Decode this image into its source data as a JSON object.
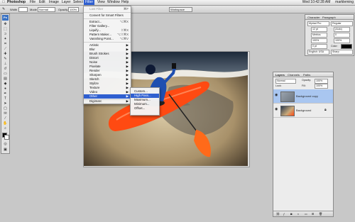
{
  "menubar": {
    "app": "Photoshop",
    "items": [
      "File",
      "Edit",
      "Image",
      "Layer",
      "Select",
      "Filter",
      "View",
      "Window",
      "Help"
    ],
    "clock": "Wed 10:42:28 AM",
    "user": "markleming"
  },
  "options": {
    "width_label": "Width",
    "mode_label": "Mode",
    "mode_value": "Normal",
    "opacity_label": "Opacity",
    "opacity_value": "100%",
    "workspace_label": "Workspace"
  },
  "toolbox": {
    "logo": "Ps"
  },
  "filter_menu": {
    "last_filter": "Last Filter",
    "last_filter_key": "⌘F",
    "convert": "Convert for Smart Filters",
    "group1": [
      {
        "label": "Extract...",
        "key": "⌥⌘X"
      },
      {
        "label": "Filter Gallery...",
        "key": ""
      },
      {
        "label": "Liquify...",
        "key": "⇧⌘X"
      },
      {
        "label": "Pattern Maker...",
        "key": "⌥⇧⌘X"
      },
      {
        "label": "Vanishing Point...",
        "key": "⌥⌘V"
      }
    ],
    "group2": [
      "Artistic",
      "Blur",
      "Brush Strokes",
      "Distort",
      "Noise",
      "Pixelate",
      "Render",
      "Sharpen",
      "Sketch",
      "Stylize",
      "Texture",
      "Video",
      "Other"
    ],
    "digimarc": "Digimarc",
    "arrow": "▶"
  },
  "other_submenu": [
    "Custom...",
    "High Pass...",
    "Maximum...",
    "Minimum...",
    "Offset..."
  ],
  "character_panel": {
    "tabs": [
      "Character",
      "Paragraph"
    ],
    "font": "Myriad Pro",
    "style": "Regular",
    "size": "12 pt",
    "leading": "(Auto)",
    "tracking": "0",
    "kerning": "Metrics",
    "scale_v": "100%",
    "scale_h": "100%",
    "baseline": "0 pt",
    "color_label": "Color:",
    "language": "English: USA",
    "aa": "Sharp"
  },
  "layers_panel": {
    "tabs": [
      "Layers",
      "Channels",
      "Paths"
    ],
    "blend": "Normal",
    "opacity_label": "Opacity:",
    "opacity": "100%",
    "lock_label": "Lock:",
    "fill_label": "Fill:",
    "fill": "100%",
    "layers": [
      {
        "name": "Background copy",
        "selected": true
      },
      {
        "name": "Background",
        "selected": false
      }
    ]
  },
  "colors": {
    "accent": "#2f5fd0",
    "kayak": "#ff4a12"
  }
}
